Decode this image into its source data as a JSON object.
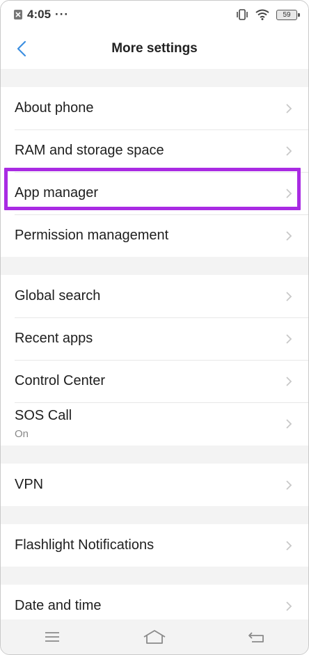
{
  "status": {
    "time": "4:05",
    "dots": "···",
    "battery": "59"
  },
  "header": {
    "title": "More settings"
  },
  "groups": [
    [
      {
        "label": "About phone"
      },
      {
        "label": "RAM and storage space"
      },
      {
        "label": "App manager"
      },
      {
        "label": "Permission management"
      }
    ],
    [
      {
        "label": "Global search"
      },
      {
        "label": "Recent apps"
      },
      {
        "label": "Control Center"
      },
      {
        "label": "SOS Call",
        "sub": "On"
      }
    ],
    [
      {
        "label": "VPN"
      }
    ],
    [
      {
        "label": "Flashlight Notifications"
      }
    ],
    [
      {
        "label": "Date and time"
      }
    ]
  ],
  "colors": {
    "accent": "#3c8fe0",
    "highlight": "#a92be3"
  }
}
